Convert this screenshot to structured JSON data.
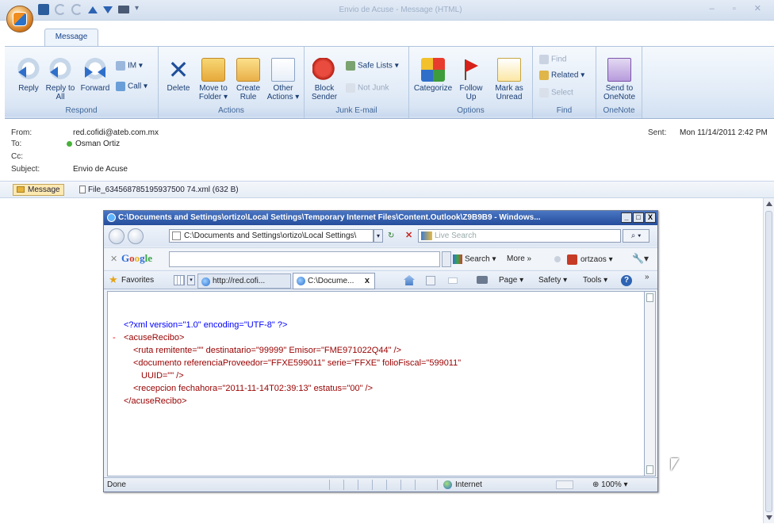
{
  "window": {
    "title": "Envio de Acuse - Message (HTML)",
    "controls": "– ▫ ✕"
  },
  "ribbon": {
    "tab": "Message",
    "respond": {
      "label": "Respond",
      "reply": "Reply",
      "reply_all": "Reply to All",
      "forward": "Forward",
      "im": "IM",
      "call": "Call"
    },
    "actions": {
      "label": "Actions",
      "delete": "Delete",
      "move_to_folder": "Move to Folder",
      "create_rule": "Create Rule",
      "other_actions": "Other Actions"
    },
    "junk": {
      "label": "Junk E-mail",
      "block_sender": "Block Sender",
      "safe_lists": "Safe Lists",
      "not_junk": "Not Junk"
    },
    "options": {
      "label": "Options",
      "categorize": "Categorize",
      "follow_up": "Follow Up",
      "mark_as_unread": "Mark as Unread"
    },
    "find": {
      "label": "Find",
      "find": "Find",
      "related": "Related",
      "select": "Select"
    },
    "onenote": {
      "label": "OneNote",
      "send_to_onenote": "Send to OneNote"
    }
  },
  "header": {
    "from_label": "From:",
    "from_value": "red.cofidi@ateb.com.mx",
    "to_label": "To:",
    "to_value": "Osman Ortiz",
    "cc_label": "Cc:",
    "cc_value": "",
    "subject_label": "Subject:",
    "subject_value": "Envio de Acuse",
    "sent_label": "Sent:",
    "sent_value": "Mon 11/14/2011 2:42 PM"
  },
  "attachments": {
    "message_label": "Message",
    "file": "File_634568785195937500 74.xml (632 B)"
  },
  "ie": {
    "title": "C:\\Documents and Settings\\ortizo\\Local Settings\\Temporary Internet Files\\Content.Outlook\\Z9B9B9 - Windows...",
    "title_controls": [
      "_",
      "□",
      "X"
    ],
    "address": "C:\\Documents and Settings\\ortizo\\Local Settings\\",
    "search_placeholder": "Live Search",
    "google": {
      "search_label": "Search",
      "more_label": "More »",
      "user_label": "ortzaos"
    },
    "favorites_label": "Favorites",
    "tab1_label": "http://red.cofi...",
    "tab2_label": "C:\\Docume...",
    "commands": {
      "page": "Page ▾",
      "safety": "Safety ▾",
      "tools": "Tools ▾"
    },
    "xml": {
      "decl_open": "<?xml version=\"1.0\" encoding=\"UTF-8\" ?>",
      "root_open": "<acuseRecibo>",
      "ruta_line": "<ruta remitente=\"\" destinatario=\"99999\" Emisor=\"FME971022Q44\" />",
      "doc_line1": "<documento referenciaProveedor=\"FFXE599011\" serie=\"FFXE\" folioFiscal=\"599011\"",
      "doc_line2": "UUID=\"\" />",
      "recepcion_line": "<recepcion fechahora=\"2011-11-14T02:39:13\" estatus=\"00\" />",
      "root_close": "</acuseRecibo>",
      "collapse_marker": "-"
    },
    "status": {
      "done": "Done",
      "zone": "Internet",
      "zoom": "100%"
    }
  }
}
